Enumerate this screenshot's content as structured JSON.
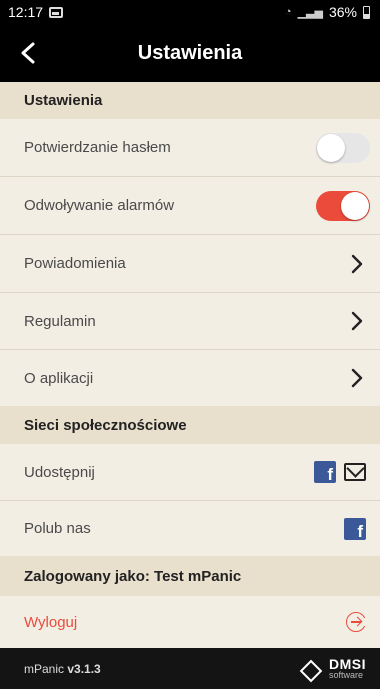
{
  "status_bar": {
    "time": "12:17",
    "battery": "36%"
  },
  "app_bar": {
    "title": "Ustawienia"
  },
  "sections": {
    "settings": {
      "header": "Ustawienia"
    },
    "social": {
      "header": "Sieci społecznościowe"
    },
    "account": {
      "header": "Zalogowany jako: Test mPanic"
    }
  },
  "settings_items": {
    "password_confirm": {
      "label": "Potwierdzanie hasłem",
      "enabled": false
    },
    "alarm_cancel": {
      "label": "Odwoływanie alarmów",
      "enabled": true
    },
    "notifications": {
      "label": "Powiadomienia"
    },
    "terms": {
      "label": "Regulamin"
    },
    "about": {
      "label": "O aplikacji"
    }
  },
  "social_items": {
    "share": {
      "label": "Udostępnij",
      "icons": [
        "facebook-icon",
        "mail-icon"
      ]
    },
    "like": {
      "label": "Polub nas",
      "icons": [
        "facebook-icon"
      ]
    }
  },
  "account_items": {
    "logout": {
      "label": "Wyloguj"
    }
  },
  "footer": {
    "app_name": "mPanic",
    "version": "v3.1.3",
    "brand_name": "DMSI",
    "brand_sub": "software"
  },
  "colors": {
    "accent_red": "#ea4b3a",
    "facebook_blue": "#3b5998",
    "section_bg": "#e8dfcc",
    "page_bg": "#f3eee4"
  }
}
